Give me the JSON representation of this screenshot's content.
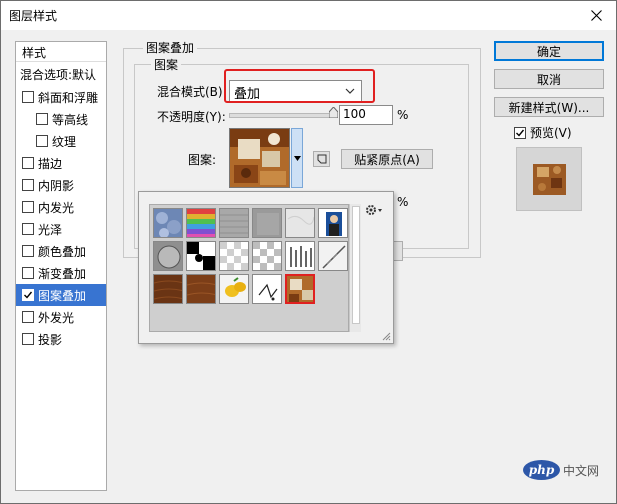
{
  "window": {
    "title": "图层样式"
  },
  "styles_panel": {
    "header": "样式",
    "blend_options": "混合选项:默认",
    "items": [
      {
        "label": "斜面和浮雕",
        "checked": false,
        "indent": false,
        "selected": false
      },
      {
        "label": "等高线",
        "checked": false,
        "indent": true,
        "selected": false
      },
      {
        "label": "纹理",
        "checked": false,
        "indent": true,
        "selected": false
      },
      {
        "label": "描边",
        "checked": false,
        "indent": false,
        "selected": false
      },
      {
        "label": "内阴影",
        "checked": false,
        "indent": false,
        "selected": false
      },
      {
        "label": "内发光",
        "checked": false,
        "indent": false,
        "selected": false
      },
      {
        "label": "光泽",
        "checked": false,
        "indent": false,
        "selected": false
      },
      {
        "label": "颜色叠加",
        "checked": false,
        "indent": false,
        "selected": false
      },
      {
        "label": "渐变叠加",
        "checked": false,
        "indent": false,
        "selected": false
      },
      {
        "label": "图案叠加",
        "checked": true,
        "indent": false,
        "selected": true
      },
      {
        "label": "外发光",
        "checked": false,
        "indent": false,
        "selected": false
      },
      {
        "label": "投影",
        "checked": false,
        "indent": false,
        "selected": false
      }
    ]
  },
  "pattern_overlay": {
    "group_title": "图案叠加",
    "subgroup_title": "图案",
    "blend_mode_label": "混合模式(B):",
    "blend_mode_value": "叠加",
    "opacity_label": "不透明度(Y):",
    "opacity_value": "100",
    "opacity_unit": "%",
    "opacity_level": 1.0,
    "scale_unit": "%",
    "pattern_label": "图案:",
    "snap_button": "贴紧原点(A)"
  },
  "picker": {
    "selected_index": 16
  },
  "buttons": {
    "ok": "确定",
    "cancel": "取消",
    "new_style": "新建样式(W)...",
    "preview_label": "预览(V)",
    "preview_checked": true
  },
  "watermark": {
    "logo": "php",
    "text": "中文网"
  },
  "colors": {
    "selection": "#3874d1",
    "highlight_red": "#e02020",
    "default_button": "#0078d7"
  }
}
